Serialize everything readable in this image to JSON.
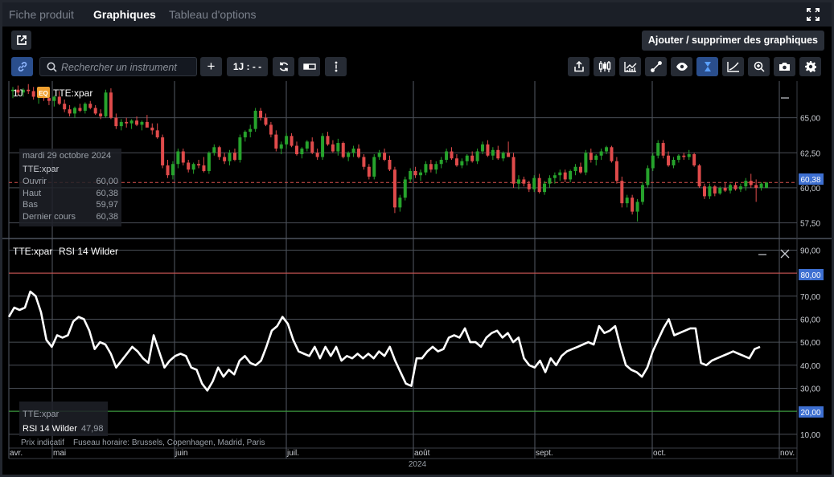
{
  "tabs": [
    {
      "label": "Fiche produit",
      "active": false
    },
    {
      "label": "Graphiques",
      "active": true
    },
    {
      "label": "Tableau d'options",
      "active": false
    }
  ],
  "add_button_label": "Ajouter / supprimer des graphiques",
  "toolbar": {
    "search_placeholder": "Rechercher un instrument",
    "plus_label": "+",
    "interval_label": "1J : - -"
  },
  "price_panel": {
    "interval": "1J",
    "badge": "EQ",
    "symbol": "TTE:xpar",
    "current_price_label": "60,38",
    "accent_color": "#3d6fd1"
  },
  "tooltip": {
    "date": "mardi 29 octobre 2024",
    "symbol": "TTE:xpar",
    "rows": [
      {
        "label": "Ouvrir",
        "value": "60,00"
      },
      {
        "label": "Haut",
        "value": "60,38"
      },
      {
        "label": "Bas",
        "value": "59,97"
      },
      {
        "label": "Dernier cours",
        "value": "60,38"
      }
    ]
  },
  "rsi_panel": {
    "title_symbol": "TTE:xpar",
    "title_indicator": "RSI 14 Wilder",
    "upper_band_label": "80,00",
    "lower_band_label": "20,00",
    "legend_symbol": "TTE:xpar",
    "legend_indicator": "RSI 14 Wilder",
    "legend_value": "47,98"
  },
  "footer": {
    "note_indicative": "Prix indicatif",
    "note_timezone": "Fuseau horaire: Brussels, Copenhagen, Madrid, Paris",
    "year": "2024"
  },
  "chart_data": [
    {
      "type": "candlestick",
      "symbol": "TTE:xpar",
      "y_ticks": [
        "65,00",
        "62,50",
        "60,00",
        "57,50"
      ],
      "y_tick_values": [
        65,
        62.5,
        60,
        57.5
      ],
      "ylim": [
        56.5,
        67.5
      ],
      "x_tick_labels": [
        "avr.",
        "mai",
        "juin",
        "juil.",
        "août",
        "sept.",
        "oct.",
        "nov."
      ],
      "reference_line": 60.38,
      "up_color": "#26a32c",
      "down_color": "#e04b4b",
      "candles": [
        {
          "o": 66.9,
          "h": 67.2,
          "l": 66.4,
          "c": 67.0
        },
        {
          "o": 67.0,
          "h": 67.3,
          "l": 66.6,
          "c": 66.8
        },
        {
          "o": 66.8,
          "h": 67.1,
          "l": 66.5,
          "c": 67.0
        },
        {
          "o": 67.0,
          "h": 67.4,
          "l": 66.7,
          "c": 66.9
        },
        {
          "o": 66.9,
          "h": 67.2,
          "l": 66.3,
          "c": 66.5
        },
        {
          "o": 66.5,
          "h": 66.9,
          "l": 66.0,
          "c": 66.7
        },
        {
          "o": 66.7,
          "h": 67.0,
          "l": 66.2,
          "c": 66.4
        },
        {
          "o": 66.4,
          "h": 66.8,
          "l": 65.9,
          "c": 66.2
        },
        {
          "o": 66.2,
          "h": 66.6,
          "l": 65.8,
          "c": 66.5
        },
        {
          "o": 66.5,
          "h": 66.9,
          "l": 65.9,
          "c": 66.0
        },
        {
          "o": 66.0,
          "h": 66.3,
          "l": 65.4,
          "c": 65.6
        },
        {
          "o": 65.6,
          "h": 65.9,
          "l": 65.1,
          "c": 65.3
        },
        {
          "o": 65.3,
          "h": 65.8,
          "l": 65.0,
          "c": 65.7
        },
        {
          "o": 65.7,
          "h": 66.0,
          "l": 65.4,
          "c": 65.5
        },
        {
          "o": 65.5,
          "h": 66.1,
          "l": 65.3,
          "c": 66.0
        },
        {
          "o": 66.0,
          "h": 66.2,
          "l": 65.6,
          "c": 65.7
        },
        {
          "o": 65.7,
          "h": 65.9,
          "l": 65.2,
          "c": 65.3
        },
        {
          "o": 65.3,
          "h": 65.6,
          "l": 64.9,
          "c": 65.1
        },
        {
          "o": 65.1,
          "h": 67.0,
          "l": 65.0,
          "c": 66.8
        },
        {
          "o": 66.8,
          "h": 67.1,
          "l": 64.9,
          "c": 65.0
        },
        {
          "o": 65.0,
          "h": 65.3,
          "l": 64.2,
          "c": 64.4
        },
        {
          "o": 64.4,
          "h": 64.9,
          "l": 64.1,
          "c": 64.7
        },
        {
          "o": 64.7,
          "h": 65.0,
          "l": 64.3,
          "c": 64.6
        },
        {
          "o": 64.6,
          "h": 64.9,
          "l": 64.2,
          "c": 64.8
        },
        {
          "o": 64.8,
          "h": 65.1,
          "l": 64.4,
          "c": 64.5
        },
        {
          "o": 64.5,
          "h": 64.8,
          "l": 64.1,
          "c": 64.7
        },
        {
          "o": 64.7,
          "h": 65.2,
          "l": 64.4,
          "c": 64.3
        },
        {
          "o": 64.3,
          "h": 64.6,
          "l": 63.8,
          "c": 64.1
        },
        {
          "o": 64.1,
          "h": 64.6,
          "l": 63.5,
          "c": 63.6
        },
        {
          "o": 63.6,
          "h": 63.8,
          "l": 61.4,
          "c": 61.6
        },
        {
          "o": 61.6,
          "h": 62.0,
          "l": 60.7,
          "c": 60.9
        },
        {
          "o": 60.9,
          "h": 61.9,
          "l": 60.6,
          "c": 61.7
        },
        {
          "o": 61.7,
          "h": 62.8,
          "l": 61.4,
          "c": 62.6
        },
        {
          "o": 62.6,
          "h": 62.8,
          "l": 61.6,
          "c": 61.8
        },
        {
          "o": 61.8,
          "h": 62.0,
          "l": 61.1,
          "c": 61.3
        },
        {
          "o": 61.3,
          "h": 61.8,
          "l": 61.0,
          "c": 61.7
        },
        {
          "o": 61.7,
          "h": 62.0,
          "l": 61.4,
          "c": 61.6
        },
        {
          "o": 61.6,
          "h": 62.2,
          "l": 61.1,
          "c": 61.2
        },
        {
          "o": 61.2,
          "h": 62.6,
          "l": 61.0,
          "c": 62.5
        },
        {
          "o": 62.5,
          "h": 63.1,
          "l": 62.3,
          "c": 62.9
        },
        {
          "o": 62.9,
          "h": 63.0,
          "l": 62.0,
          "c": 62.2
        },
        {
          "o": 62.2,
          "h": 62.5,
          "l": 61.7,
          "c": 61.9
        },
        {
          "o": 61.9,
          "h": 62.7,
          "l": 61.6,
          "c": 62.5
        },
        {
          "o": 62.5,
          "h": 62.8,
          "l": 61.9,
          "c": 62.0
        },
        {
          "o": 62.0,
          "h": 63.8,
          "l": 61.8,
          "c": 63.6
        },
        {
          "o": 63.6,
          "h": 64.1,
          "l": 63.3,
          "c": 64.0
        },
        {
          "o": 64.0,
          "h": 64.5,
          "l": 63.6,
          "c": 64.2
        },
        {
          "o": 64.2,
          "h": 65.7,
          "l": 64.0,
          "c": 65.5
        },
        {
          "o": 65.5,
          "h": 65.7,
          "l": 64.8,
          "c": 65.0
        },
        {
          "o": 65.0,
          "h": 65.3,
          "l": 64.4,
          "c": 64.5
        },
        {
          "o": 64.5,
          "h": 64.7,
          "l": 63.6,
          "c": 63.8
        },
        {
          "o": 63.8,
          "h": 64.1,
          "l": 62.6,
          "c": 62.8
        },
        {
          "o": 62.8,
          "h": 63.3,
          "l": 62.4,
          "c": 63.1
        },
        {
          "o": 63.1,
          "h": 63.9,
          "l": 62.8,
          "c": 63.7
        },
        {
          "o": 63.7,
          "h": 63.9,
          "l": 62.9,
          "c": 63.0
        },
        {
          "o": 63.0,
          "h": 63.3,
          "l": 62.3,
          "c": 62.4
        },
        {
          "o": 62.4,
          "h": 62.9,
          "l": 62.1,
          "c": 62.8
        },
        {
          "o": 62.8,
          "h": 63.4,
          "l": 62.6,
          "c": 63.3
        },
        {
          "o": 63.3,
          "h": 63.6,
          "l": 62.4,
          "c": 62.5
        },
        {
          "o": 62.5,
          "h": 62.8,
          "l": 62.0,
          "c": 62.2
        },
        {
          "o": 62.2,
          "h": 63.9,
          "l": 62.0,
          "c": 63.7
        },
        {
          "o": 63.7,
          "h": 64.0,
          "l": 63.0,
          "c": 63.1
        },
        {
          "o": 63.1,
          "h": 63.4,
          "l": 62.5,
          "c": 62.6
        },
        {
          "o": 62.6,
          "h": 63.5,
          "l": 62.3,
          "c": 63.2
        },
        {
          "o": 63.2,
          "h": 63.3,
          "l": 62.1,
          "c": 62.2
        },
        {
          "o": 62.2,
          "h": 62.6,
          "l": 61.9,
          "c": 62.5
        },
        {
          "o": 62.5,
          "h": 63.0,
          "l": 62.2,
          "c": 62.8
        },
        {
          "o": 62.8,
          "h": 63.1,
          "l": 62.1,
          "c": 62.2
        },
        {
          "o": 62.2,
          "h": 62.4,
          "l": 61.3,
          "c": 61.5
        },
        {
          "o": 61.5,
          "h": 61.7,
          "l": 60.6,
          "c": 60.8
        },
        {
          "o": 60.8,
          "h": 62.4,
          "l": 60.6,
          "c": 62.2
        },
        {
          "o": 62.2,
          "h": 62.7,
          "l": 62.0,
          "c": 62.5
        },
        {
          "o": 62.5,
          "h": 62.8,
          "l": 61.9,
          "c": 62.0
        },
        {
          "o": 62.0,
          "h": 62.3,
          "l": 61.2,
          "c": 61.3
        },
        {
          "o": 61.3,
          "h": 61.5,
          "l": 58.2,
          "c": 58.6
        },
        {
          "o": 58.6,
          "h": 59.5,
          "l": 58.3,
          "c": 59.3
        },
        {
          "o": 59.3,
          "h": 60.8,
          "l": 59.1,
          "c": 60.6
        },
        {
          "o": 60.6,
          "h": 61.4,
          "l": 60.4,
          "c": 61.2
        },
        {
          "o": 61.2,
          "h": 61.5,
          "l": 60.7,
          "c": 60.9
        },
        {
          "o": 60.9,
          "h": 61.3,
          "l": 60.5,
          "c": 61.1
        },
        {
          "o": 61.1,
          "h": 61.9,
          "l": 60.9,
          "c": 61.7
        },
        {
          "o": 61.7,
          "h": 62.0,
          "l": 61.1,
          "c": 61.3
        },
        {
          "o": 61.3,
          "h": 61.9,
          "l": 61.0,
          "c": 61.7
        },
        {
          "o": 61.7,
          "h": 62.2,
          "l": 61.4,
          "c": 62.0
        },
        {
          "o": 62.0,
          "h": 62.8,
          "l": 61.8,
          "c": 62.6
        },
        {
          "o": 62.6,
          "h": 62.9,
          "l": 62.0,
          "c": 62.1
        },
        {
          "o": 62.1,
          "h": 62.4,
          "l": 61.5,
          "c": 61.6
        },
        {
          "o": 61.6,
          "h": 62.1,
          "l": 61.4,
          "c": 61.9
        },
        {
          "o": 61.9,
          "h": 62.4,
          "l": 61.6,
          "c": 62.3
        },
        {
          "o": 62.3,
          "h": 62.6,
          "l": 61.8,
          "c": 61.9
        },
        {
          "o": 61.9,
          "h": 62.8,
          "l": 61.7,
          "c": 62.6
        },
        {
          "o": 62.6,
          "h": 63.3,
          "l": 62.4,
          "c": 63.1
        },
        {
          "o": 63.1,
          "h": 63.4,
          "l": 62.2,
          "c": 62.3
        },
        {
          "o": 62.3,
          "h": 62.9,
          "l": 62.0,
          "c": 62.7
        },
        {
          "o": 62.7,
          "h": 63.0,
          "l": 62.0,
          "c": 62.1
        },
        {
          "o": 62.1,
          "h": 62.6,
          "l": 61.9,
          "c": 62.5
        },
        {
          "o": 62.5,
          "h": 63.3,
          "l": 62.3,
          "c": 62.2
        },
        {
          "o": 62.2,
          "h": 62.5,
          "l": 60.0,
          "c": 60.3
        },
        {
          "o": 60.3,
          "h": 60.9,
          "l": 59.9,
          "c": 60.6
        },
        {
          "o": 60.6,
          "h": 60.8,
          "l": 60.1,
          "c": 60.3
        },
        {
          "o": 60.3,
          "h": 60.5,
          "l": 59.7,
          "c": 59.9
        },
        {
          "o": 59.9,
          "h": 60.9,
          "l": 59.7,
          "c": 60.7
        },
        {
          "o": 60.7,
          "h": 61.0,
          "l": 59.6,
          "c": 59.7
        },
        {
          "o": 59.7,
          "h": 60.5,
          "l": 59.5,
          "c": 60.3
        },
        {
          "o": 60.3,
          "h": 60.9,
          "l": 60.0,
          "c": 60.7
        },
        {
          "o": 60.7,
          "h": 61.1,
          "l": 60.3,
          "c": 60.9
        },
        {
          "o": 60.9,
          "h": 61.3,
          "l": 60.5,
          "c": 61.1
        },
        {
          "o": 61.1,
          "h": 61.3,
          "l": 60.4,
          "c": 60.6
        },
        {
          "o": 60.6,
          "h": 61.3,
          "l": 60.4,
          "c": 61.2
        },
        {
          "o": 61.2,
          "h": 61.7,
          "l": 60.9,
          "c": 61.5
        },
        {
          "o": 61.5,
          "h": 61.8,
          "l": 61.0,
          "c": 61.1
        },
        {
          "o": 61.1,
          "h": 62.7,
          "l": 60.9,
          "c": 62.5
        },
        {
          "o": 62.5,
          "h": 62.8,
          "l": 61.8,
          "c": 62.0
        },
        {
          "o": 62.0,
          "h": 62.4,
          "l": 61.6,
          "c": 62.3
        },
        {
          "o": 62.3,
          "h": 62.8,
          "l": 62.0,
          "c": 62.6
        },
        {
          "o": 62.6,
          "h": 63.0,
          "l": 62.4,
          "c": 62.9
        },
        {
          "o": 62.9,
          "h": 63.0,
          "l": 61.8,
          "c": 61.9
        },
        {
          "o": 61.9,
          "h": 62.2,
          "l": 60.3,
          "c": 60.5
        },
        {
          "o": 60.5,
          "h": 60.8,
          "l": 58.6,
          "c": 58.9
        },
        {
          "o": 58.9,
          "h": 59.5,
          "l": 58.6,
          "c": 59.3
        },
        {
          "o": 59.3,
          "h": 59.5,
          "l": 58.1,
          "c": 58.3
        },
        {
          "o": 58.3,
          "h": 59.2,
          "l": 57.6,
          "c": 59.0
        },
        {
          "o": 59.0,
          "h": 60.4,
          "l": 58.8,
          "c": 60.2
        },
        {
          "o": 60.2,
          "h": 61.6,
          "l": 60.0,
          "c": 61.4
        },
        {
          "o": 61.4,
          "h": 62.5,
          "l": 61.2,
          "c": 62.3
        },
        {
          "o": 62.3,
          "h": 63.4,
          "l": 62.1,
          "c": 63.2
        },
        {
          "o": 63.2,
          "h": 63.4,
          "l": 62.1,
          "c": 62.3
        },
        {
          "o": 62.3,
          "h": 62.6,
          "l": 61.5,
          "c": 61.6
        },
        {
          "o": 61.6,
          "h": 62.2,
          "l": 61.4,
          "c": 62.0
        },
        {
          "o": 62.0,
          "h": 62.4,
          "l": 61.8,
          "c": 62.3
        },
        {
          "o": 62.3,
          "h": 62.5,
          "l": 62.0,
          "c": 62.2
        },
        {
          "o": 62.2,
          "h": 62.7,
          "l": 62.0,
          "c": 62.4
        },
        {
          "o": 62.4,
          "h": 62.5,
          "l": 61.5,
          "c": 61.6
        },
        {
          "o": 61.6,
          "h": 61.7,
          "l": 60.0,
          "c": 60.1
        },
        {
          "o": 60.1,
          "h": 60.3,
          "l": 59.2,
          "c": 59.4
        },
        {
          "o": 59.4,
          "h": 60.3,
          "l": 59.2,
          "c": 60.1
        },
        {
          "o": 60.1,
          "h": 60.2,
          "l": 59.4,
          "c": 59.6
        },
        {
          "o": 59.6,
          "h": 60.1,
          "l": 59.5,
          "c": 60.0
        },
        {
          "o": 60.0,
          "h": 60.4,
          "l": 59.7,
          "c": 59.8
        },
        {
          "o": 59.8,
          "h": 60.3,
          "l": 59.6,
          "c": 60.2
        },
        {
          "o": 60.2,
          "h": 60.4,
          "l": 59.8,
          "c": 59.9
        },
        {
          "o": 59.9,
          "h": 60.3,
          "l": 59.7,
          "c": 60.1
        },
        {
          "o": 60.1,
          "h": 60.7,
          "l": 59.8,
          "c": 60.5
        },
        {
          "o": 60.5,
          "h": 61.0,
          "l": 60.0,
          "c": 60.2
        },
        {
          "o": 60.2,
          "h": 60.6,
          "l": 59.0,
          "c": 60.0
        },
        {
          "o": 60.0,
          "h": 60.4,
          "l": 59.8,
          "c": 60.3
        },
        {
          "o": 60.0,
          "h": 60.38,
          "l": 59.97,
          "c": 60.38
        }
      ]
    },
    {
      "type": "line",
      "name": "RSI 14 Wilder",
      "y_ticks": [
        "90,00",
        "80,00",
        "70,00",
        "60,00",
        "50,00",
        "40,00",
        "30,00",
        "20,00",
        "10,00"
      ],
      "y_tick_values": [
        90,
        80,
        70,
        60,
        50,
        40,
        30,
        20,
        10
      ],
      "ylim": [
        4,
        94
      ],
      "bands": [
        {
          "value": 80,
          "color": "#d9534f"
        },
        {
          "value": 20,
          "color": "#3caa3c"
        }
      ],
      "line_color": "#ffffff",
      "values": [
        61,
        65,
        64,
        65,
        72,
        70,
        63,
        51,
        48,
        53,
        52,
        53,
        59,
        61,
        60,
        55,
        47,
        50,
        49,
        45,
        39,
        42,
        45,
        48,
        46,
        43,
        41,
        53,
        46,
        39,
        42,
        44,
        45,
        44,
        39,
        38,
        32,
        29,
        33,
        39,
        35,
        38,
        36,
        42,
        44,
        41,
        40,
        42,
        48,
        55,
        57,
        61,
        58,
        51,
        46,
        45,
        44,
        48,
        43,
        48,
        44,
        48,
        42,
        44,
        43,
        45,
        43,
        45,
        43,
        46,
        44,
        48,
        42,
        37,
        32,
        31,
        43,
        43,
        46,
        48,
        46,
        47,
        52,
        53,
        52,
        56,
        50,
        50,
        48,
        52,
        54,
        55,
        52,
        54,
        50,
        52,
        43,
        40,
        39,
        42,
        37,
        43,
        40,
        44,
        46,
        47,
        48,
        49,
        50,
        49,
        57,
        54,
        55,
        57,
        48,
        40,
        38,
        37,
        35,
        39,
        46,
        51,
        56,
        60,
        53,
        54,
        55,
        56,
        56,
        41,
        40,
        42,
        43,
        44,
        45,
        46,
        45,
        44,
        43,
        47,
        48
      ]
    }
  ]
}
